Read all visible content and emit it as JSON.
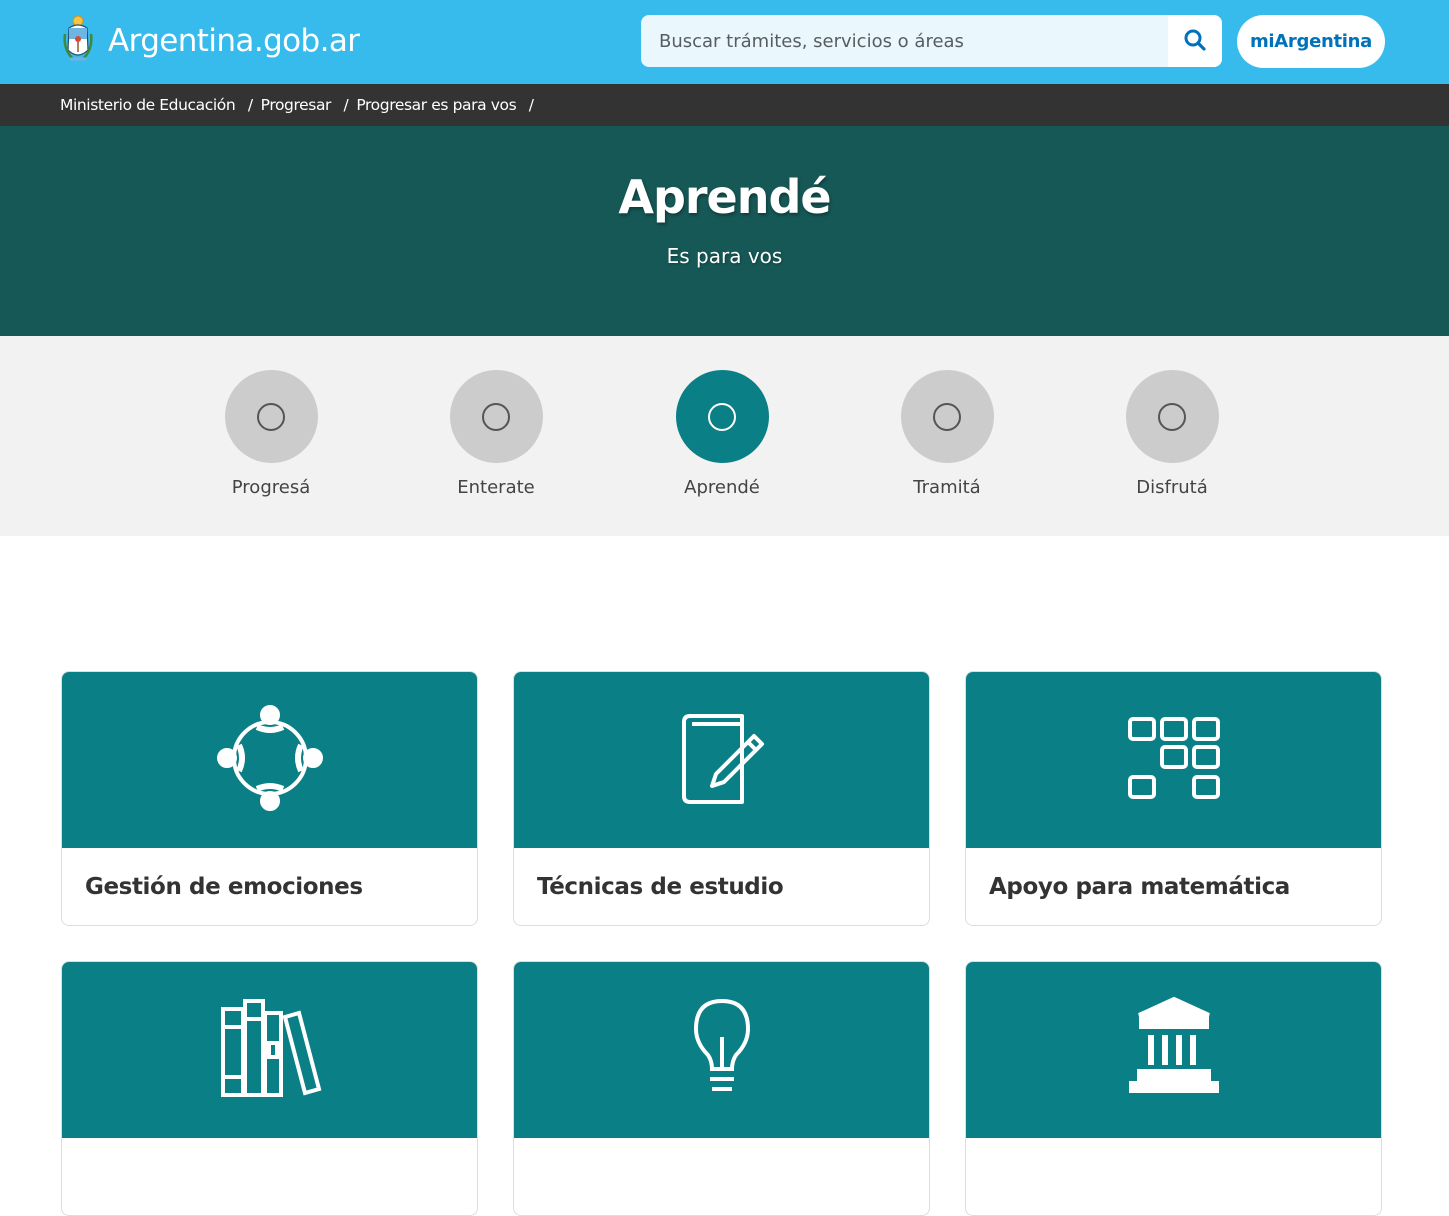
{
  "header": {
    "brand": "Argentina.gob.ar",
    "search_placeholder": "Buscar trámites, servicios o áreas",
    "mi_button": "miArgentina"
  },
  "breadcrumb": [
    {
      "label": "Ministerio de Educación"
    },
    {
      "label": "Progresar"
    },
    {
      "label": "Progresar es para vos"
    }
  ],
  "breadcrumb_separator": "/",
  "hero": {
    "title": "Aprendé",
    "subtitle": "Es para vos"
  },
  "subnav": {
    "active": "Aprendé",
    "items": [
      {
        "label": "Progresá",
        "icon": "circle-icon"
      },
      {
        "label": "Enterate",
        "icon": "circle-icon"
      },
      {
        "label": "Aprendé",
        "icon": "circle-icon"
      },
      {
        "label": "Tramitá",
        "icon": "circle-icon"
      },
      {
        "label": "Disfrutá",
        "icon": "circle-icon"
      }
    ]
  },
  "cards": [
    {
      "title": "Gestión de emociones",
      "icon": "people-circle-icon"
    },
    {
      "title": "Técnicas de estudio",
      "icon": "notebook-pencil-icon"
    },
    {
      "title": "Apoyo para matemática",
      "icon": "grid-blocks-icon"
    },
    {
      "title": "",
      "icon": "books-icon"
    },
    {
      "title": "",
      "icon": "lightbulb-icon"
    },
    {
      "title": "",
      "icon": "institution-icon"
    }
  ],
  "colors": {
    "header_bg": "#37bbed",
    "breadcrumb_bg": "#333333",
    "hero_bg": "#165856",
    "accent_teal": "#0b7f86",
    "subnav_bg": "#f2f2f2",
    "inactive_circle": "#cccccc",
    "link_blue": "#0072bb"
  }
}
